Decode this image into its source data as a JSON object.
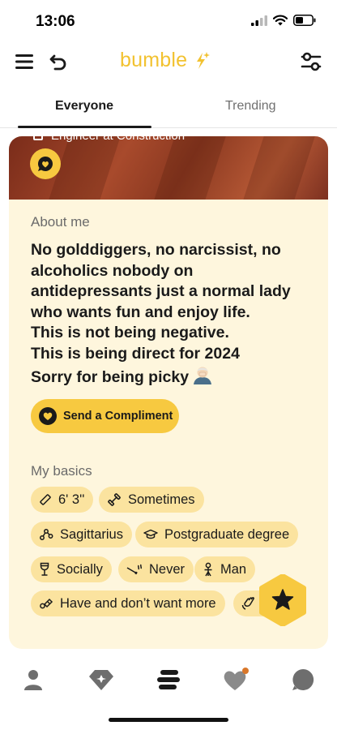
{
  "status_bar": {
    "time": "13:06"
  },
  "header": {
    "logo_text": "bumble",
    "brand_color": "#f2c230"
  },
  "tabs": [
    {
      "label": "Everyone",
      "active": true
    },
    {
      "label": "Trending",
      "active": false
    }
  ],
  "profile": {
    "job": "Engineer at Construction",
    "about_label": "About me",
    "about_text": "No golddiggers, no narcissist, no alcoholics nobody on antidepressants just a normal lady who wants fun and enjoy life.\nThis is not being negative.\nThis is being direct for 2024\nSorry for being picky",
    "compliment_button": "Send a Compliment",
    "basics_label": "My basics",
    "basics": [
      {
        "icon": "ruler-icon",
        "label": "6' 3''"
      },
      {
        "icon": "dumbbell-icon",
        "label": "Sometimes"
      },
      {
        "icon": "zodiac-icon",
        "label": "Sagittarius"
      },
      {
        "icon": "graduation-cap-icon",
        "label": "Postgraduate degree"
      },
      {
        "icon": "wine-glass-icon",
        "label": "Socially"
      },
      {
        "icon": "cigarette-icon",
        "label": "Never"
      },
      {
        "icon": "gender-icon",
        "label": "Man"
      },
      {
        "icon": "pacifier-icon",
        "label": "Have and don’t want more"
      }
    ]
  },
  "colors": {
    "card_bg": "#fef6dd",
    "chip_bg": "#fbe39f",
    "accent": "#f7c940"
  },
  "bottom_nav": [
    {
      "icon": "profile-icon"
    },
    {
      "icon": "diamond-icon"
    },
    {
      "icon": "bumble-stack-icon",
      "active": true
    },
    {
      "icon": "likes-heart-icon",
      "badge": true
    },
    {
      "icon": "chat-bubble-icon"
    }
  ]
}
